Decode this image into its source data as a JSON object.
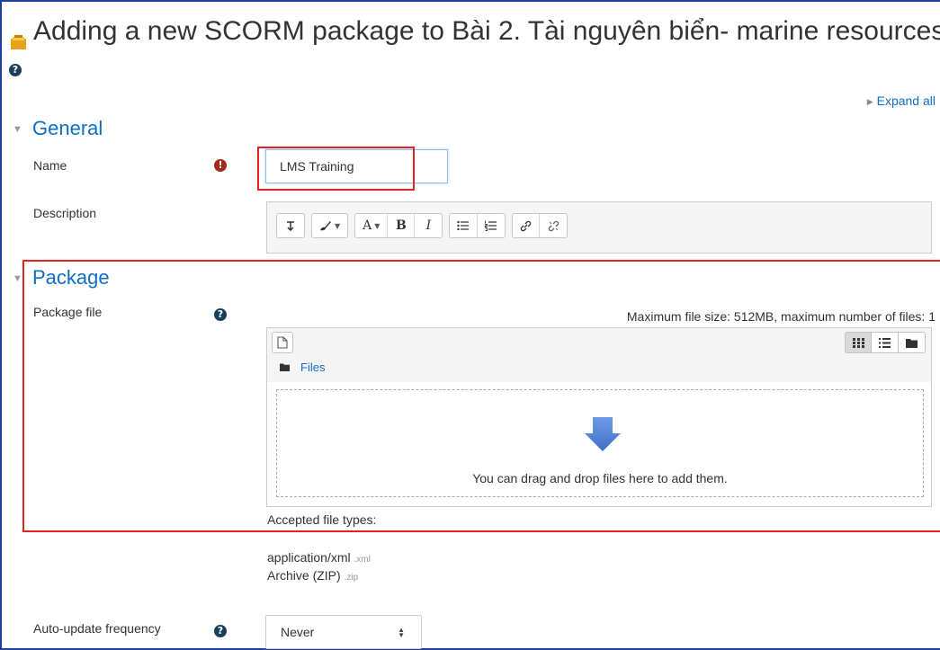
{
  "page": {
    "title": "Adding a new SCORM package to Bài 2. Tài nguyên biển- marine resources",
    "expand_all": "Expand all"
  },
  "general": {
    "heading": "General",
    "name_label": "Name",
    "name_value": "LMS Training",
    "description_label": "Description",
    "toolbar": {
      "font_size_label": "A",
      "bold_label": "B",
      "italic_label": "I"
    }
  },
  "package": {
    "heading": "Package",
    "file_label": "Package file",
    "max_info": "Maximum file size: 512MB, maximum number of files: 1",
    "crumb_label": "Files",
    "drop_message": "You can drag and drop files here to add them.",
    "accepted_label": "Accepted file types:",
    "accepted_types": [
      {
        "name": "application/xml",
        "ext": ".xml"
      },
      {
        "name": "Archive (ZIP)",
        "ext": ".zip"
      }
    ]
  },
  "autoupdate": {
    "label": "Auto-update frequency",
    "selected": "Never"
  },
  "colors": {
    "link": "#0f6fc5",
    "required": "#a5271d",
    "help": "#1a3f5c",
    "highlight": "#e12326",
    "drop_arrow": "#4a7fd4"
  },
  "icons": [
    "scorm-package-icon",
    "help-icon",
    "required-icon",
    "paragraph-icon",
    "brush-icon",
    "unordered-list-icon",
    "ordered-list-icon",
    "link-icon",
    "unlink-icon",
    "new-file-icon",
    "grid-view-icon",
    "list-view-icon",
    "tree-view-icon",
    "folder-icon",
    "drop-arrow-icon"
  ]
}
